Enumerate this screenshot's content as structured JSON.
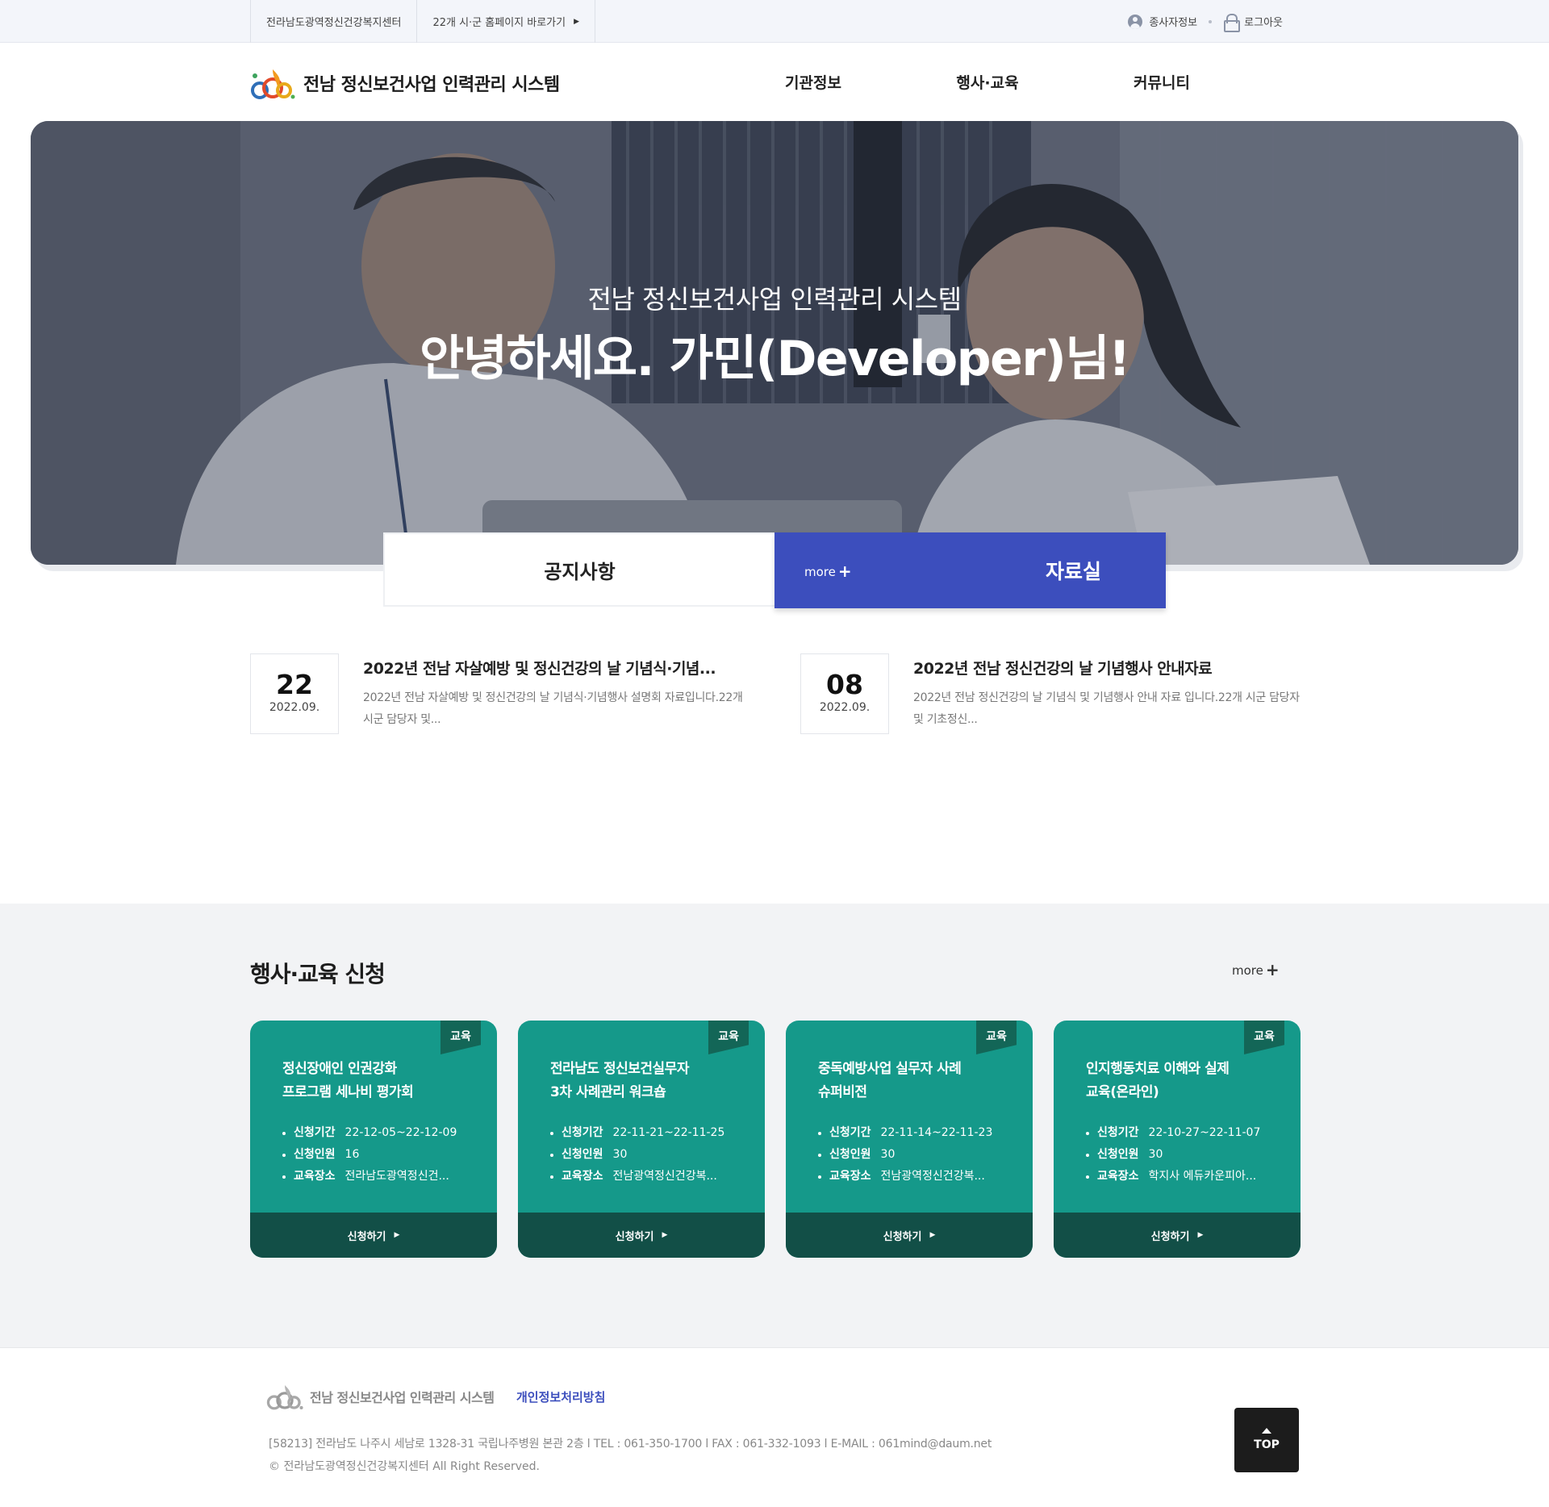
{
  "topbar": {
    "links": [
      {
        "label": "전라남도광역정신건강복지센터"
      },
      {
        "label": "22개 시·군 홈페이지 바로가기"
      }
    ],
    "user_info": "종사자정보",
    "logout": "로그아웃"
  },
  "header": {
    "logo_text": "전남 정신보건사업 인력관리 시스템",
    "menu": [
      "기관정보",
      "행사·교육",
      "커뮤니티"
    ]
  },
  "hero": {
    "subtitle": "전남 정신보건사업 인력관리 시스템",
    "greeting": "안녕하세요. 가민(Developer)님!"
  },
  "board_tabs": {
    "notice": "공지사항",
    "data": "자료실",
    "more": "more"
  },
  "posts": [
    {
      "day": "22",
      "year_month": "2022.09.",
      "title": "2022년 전남 자살예방 및 정신건강의 날 기념식·기념...",
      "desc": "2022년 전남 자살예방 및 정신건강의 날 기념식·기념행사 설명회 자료입니다.22개 시군 담당자 및..."
    },
    {
      "day": "08",
      "year_month": "2022.09.",
      "title": "2022년 전남 정신건강의 날 기념행사 안내자료",
      "desc": "2022년 전남 정신건강의 날 기념식 및 기념행사 안내 자료 입니다.22개 시군 담당자 및 기초정신..."
    }
  ],
  "programs": {
    "title": "행사·교육 신청",
    "more": "more",
    "labels": {
      "period": "신청기간",
      "count": "신청인원",
      "place": "교육장소",
      "apply": "신청하기"
    },
    "cards": [
      {
        "badge": "교육",
        "title_line1": "정신장애인 인권강화",
        "title_line2": "프로그램 세나비 평가회",
        "period": "22-12-05~22-12-09",
        "count": "16",
        "place": "전라남도광역정신건..."
      },
      {
        "badge": "교육",
        "title_line1": "전라남도 정신보건실무자",
        "title_line2": "3차 사례관리 워크숍",
        "period": "22-11-21~22-11-25",
        "count": "30",
        "place": "전남광역정신건강복..."
      },
      {
        "badge": "교육",
        "title_line1": "중독예방사업 실무자 사례",
        "title_line2": "슈퍼비전",
        "period": "22-11-14~22-11-23",
        "count": "30",
        "place": "전남광역정신건강복..."
      },
      {
        "badge": "교육",
        "title_line1": "인지행동치료 이해와 실제",
        "title_line2": "교육(온라인)",
        "period": "22-10-27~22-11-07",
        "count": "30",
        "place": "학지사 에듀카운피아..."
      }
    ]
  },
  "footer": {
    "logo_text": "전남 정신보건사업 인력관리 시스템",
    "policy": "개인정보처리방침",
    "address": "[58213] 전라남도 나주시 세남로 1328-31 국립나주병원 본관 2층 l  TEL : 061-350-1700 l  FAX : 061-332-1093  l E-MAIL : 061mind@daum.net",
    "copyright": "© 전라남도광역정신건강복지센터 All Right Reserved.",
    "top": "TOP"
  },
  "colors": {
    "primary_blue": "#3c4ebd",
    "card_teal": "#15998a",
    "card_dark": "#124f47",
    "badge": "#136657"
  }
}
